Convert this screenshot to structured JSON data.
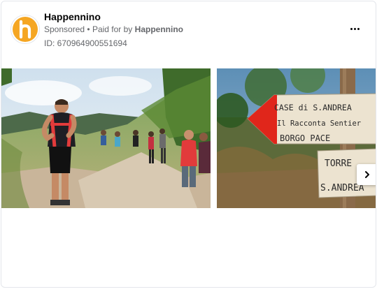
{
  "ad": {
    "page_name": "Happennino",
    "sponsored_label": "Sponsored",
    "separator": "•",
    "paid_for_prefix": "Paid for by",
    "paid_for_name": "Happennino",
    "ad_id_label": "ID: 670964900551694",
    "avatar_letter": "h",
    "more_icon": "more-horizontal-icon"
  },
  "carousel": {
    "slides": [
      {
        "alt": "hikers on mountain trail"
      },
      {
        "alt": "wooden trail signs"
      }
    ],
    "next_icon": "chevron-right-icon"
  },
  "signs": {
    "sign1_line1": "CASE di S.ANDREA",
    "sign1_line2": "Il Racconta Sentier",
    "sign1_line3": "BORGO PACE",
    "sign2_line1": "TORRE",
    "sign2_line2": "S.ANDREA"
  },
  "colors": {
    "avatar_bg": "#f5a623",
    "sign_arrow_red": "#e0261b",
    "muted_text": "#65676b"
  }
}
